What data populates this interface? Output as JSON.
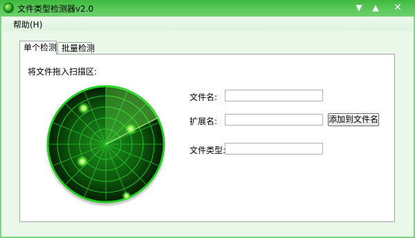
{
  "window": {
    "title": "文件类型检测器v2.0",
    "controls": {
      "menu": "▼",
      "minimize": "▲",
      "close": "✕"
    }
  },
  "menubar": {
    "items": [
      {
        "label": "帮助(H)"
      }
    ]
  },
  "tabs": [
    {
      "label": "单个检测",
      "active": true
    },
    {
      "label": "批量检测",
      "active": false
    }
  ],
  "single": {
    "drag_label": "将文件拖入扫描区:",
    "radar": {
      "icon": "radar-icon"
    },
    "fields": {
      "filename": {
        "label": "文件名:",
        "value": ""
      },
      "extension": {
        "label": "扩展名:",
        "value": ""
      },
      "filetype": {
        "label": "文件类型:",
        "value": ""
      }
    },
    "add_button": "添加到文件名"
  },
  "colors": {
    "titlebar": "#4cbf4c",
    "window_border": "#7fd67f",
    "client_bg": "#eaf8ea",
    "radar_green": "#22dd22"
  }
}
